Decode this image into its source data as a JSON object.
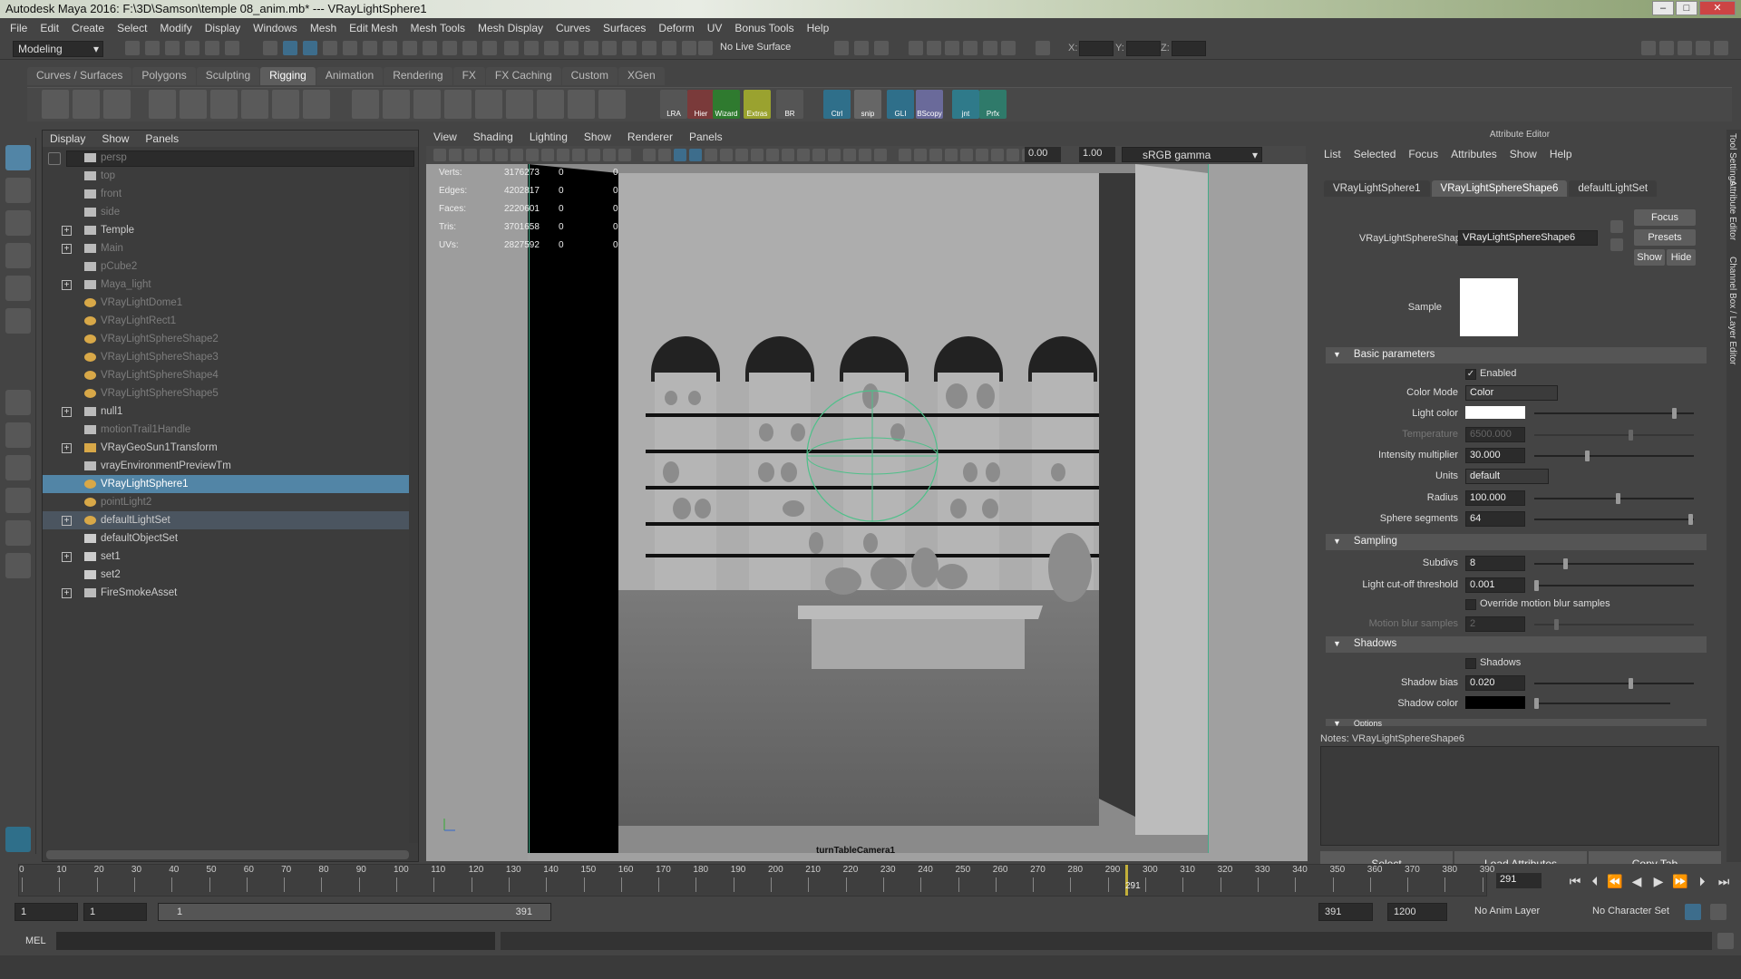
{
  "window": {
    "title": "Autodesk Maya 2016: F:\\3D\\Samson\\temple 08_anim.mb*   ---   VRayLightSphere1"
  },
  "menu": [
    "File",
    "Edit",
    "Create",
    "Select",
    "Modify",
    "Display",
    "Windows",
    "Mesh",
    "Edit Mesh",
    "Mesh Tools",
    "Mesh Display",
    "Curves",
    "Surfaces",
    "Deform",
    "UV",
    "Bonus Tools",
    "Help"
  ],
  "status": {
    "mode": "Modeling",
    "live_surface": "No Live Surface",
    "x_label": "X:",
    "y_label": "Y:",
    "z_label": "Z:"
  },
  "shelf_tabs": [
    "Curves / Surfaces",
    "Polygons",
    "Sculpting",
    "Rigging",
    "Animation",
    "Rendering",
    "FX",
    "FX Caching",
    "Custom",
    "XGen"
  ],
  "shelf_buttons": [
    "LRA",
    "Hier",
    "Wizard",
    "Extras",
    "BR",
    "Ctrl",
    "snip",
    "GLI",
    "BScopy",
    "jnt",
    "Prfx"
  ],
  "outliner": {
    "menu": [
      "Display",
      "Show",
      "Panels"
    ],
    "items": [
      {
        "label": "persp",
        "dim": true,
        "exp": false
      },
      {
        "label": "top",
        "dim": true,
        "exp": false
      },
      {
        "label": "front",
        "dim": true,
        "exp": false
      },
      {
        "label": "side",
        "dim": true,
        "exp": false
      },
      {
        "label": "Temple",
        "dim": false,
        "exp": true
      },
      {
        "label": "Main",
        "dim": true,
        "exp": true
      },
      {
        "label": "pCube2",
        "dim": true,
        "exp": false
      },
      {
        "label": "Maya_light",
        "dim": true,
        "exp": true
      },
      {
        "label": "VRayLightDome1",
        "dim": true,
        "exp": false
      },
      {
        "label": "VRayLightRect1",
        "dim": true,
        "exp": false
      },
      {
        "label": "VRayLightSphereShape2",
        "dim": true,
        "exp": false
      },
      {
        "label": "VRayLightSphereShape3",
        "dim": true,
        "exp": false
      },
      {
        "label": "VRayLightSphereShape4",
        "dim": true,
        "exp": false
      },
      {
        "label": "VRayLightSphereShape5",
        "dim": true,
        "exp": false
      },
      {
        "label": "null1",
        "dim": false,
        "exp": true
      },
      {
        "label": "motionTrail1Handle",
        "dim": true,
        "exp": false
      },
      {
        "label": "VRayGeoSun1Transform",
        "dim": false,
        "exp": true
      },
      {
        "label": "vrayEnvironmentPreviewTm",
        "dim": false,
        "exp": false
      },
      {
        "label": "VRayLightSphere1",
        "dim": false,
        "exp": false,
        "sel": true
      },
      {
        "label": "pointLight2",
        "dim": true,
        "exp": false
      },
      {
        "label": "defaultLightSet",
        "dim": false,
        "exp": true,
        "hl": true
      },
      {
        "label": "defaultObjectSet",
        "dim": false,
        "exp": false
      },
      {
        "label": "set1",
        "dim": false,
        "exp": true
      },
      {
        "label": "set2",
        "dim": false,
        "exp": false
      },
      {
        "label": "FireSmokeAsset",
        "dim": false,
        "exp": true
      }
    ]
  },
  "viewport": {
    "menu": [
      "View",
      "Shading",
      "Lighting",
      "Show",
      "Renderer",
      "Panels"
    ],
    "exposure": "0.00",
    "gamma_value": "1.00",
    "color_space": "sRGB gamma",
    "camera": "turnTableCamera1",
    "hud": [
      {
        "k": "Verts:",
        "v": "3176273",
        "a": "0",
        "b": "0"
      },
      {
        "k": "Edges:",
        "v": "4202817",
        "a": "0",
        "b": "0"
      },
      {
        "k": "Faces:",
        "v": "2220601",
        "a": "0",
        "b": "0"
      },
      {
        "k": "Tris:",
        "v": "3701658",
        "a": "0",
        "b": "0"
      },
      {
        "k": "UVs:",
        "v": "2827592",
        "a": "0",
        "b": "0"
      }
    ]
  },
  "attr": {
    "title": "Attribute Editor",
    "menu": [
      "List",
      "Selected",
      "Focus",
      "Attributes",
      "Show",
      "Help"
    ],
    "tabs": [
      "VRayLightSphere1",
      "VRayLightSphereShape6",
      "defaultLightSet"
    ],
    "node_label": "VRayLightSphereShape:",
    "node_value": "VRayLightSphereShape6",
    "focus": "Focus",
    "presets": "Presets",
    "show": "Show",
    "hide": "Hide",
    "sample": "Sample",
    "basic": "Basic parameters",
    "enabled": "Enabled",
    "color_mode_label": "Color Mode",
    "color_mode": "Color",
    "light_color": "Light color",
    "temperature_label": "Temperature",
    "temperature": "6500.000",
    "intensity_label": "Intensity multiplier",
    "intensity": "30.000",
    "units_label": "Units",
    "units": "default",
    "radius_label": "Radius",
    "radius": "100.000",
    "segments_label": "Sphere segments",
    "segments": "64",
    "sampling": "Sampling",
    "subdivs_label": "Subdivs",
    "subdivs": "8",
    "cutoff_label": "Light cut-off threshold",
    "cutoff": "0.001",
    "override_blur": "Override motion blur samples",
    "blur_label": "Motion blur samples",
    "blur": "2",
    "shadows_sect": "Shadows",
    "shadows_chk": "Shadows",
    "bias_label": "Shadow bias",
    "bias": "0.020",
    "shadow_color": "Shadow color",
    "options": "Options",
    "notes": "Notes:  VRayLightSphereShape6",
    "btn_select": "Select",
    "btn_load": "Load Attributes",
    "btn_copy": "Copy Tab",
    "colors": {
      "light": "#ffffff",
      "shadow": "#000000"
    }
  },
  "side_tabs": [
    "Tool Settings",
    "Attribute Editor",
    "Channel Box / Layer Editor"
  ],
  "timeline": {
    "ticks": [
      "0",
      "10",
      "20",
      "30",
      "40",
      "50",
      "60",
      "70",
      "80",
      "90",
      "100",
      "110",
      "120",
      "130",
      "140",
      "150",
      "160",
      "170",
      "180",
      "190",
      "200",
      "210",
      "220",
      "230",
      "240",
      "250",
      "260",
      "270",
      "280",
      "290",
      "300",
      "310",
      "320",
      "330",
      "340",
      "350",
      "360",
      "370",
      "380",
      "390"
    ],
    "current": "291",
    "current_field": "291"
  },
  "range": {
    "start": "1",
    "start2": "1",
    "slider_start": "1",
    "slider_end": "391",
    "end": "391",
    "end2": "1200",
    "anim_layer": "No Anim Layer",
    "char_set": "No Character Set"
  },
  "cmd": {
    "label": "MEL"
  }
}
